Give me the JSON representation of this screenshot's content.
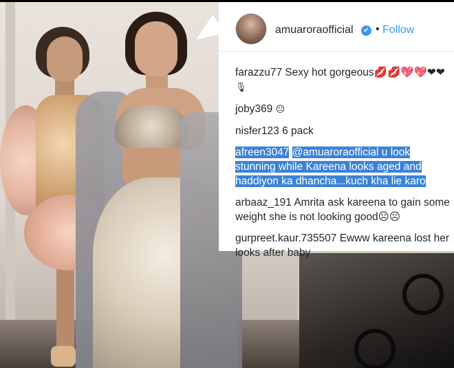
{
  "post": {
    "username": "amuaroraofficial",
    "verified_mark": "✔",
    "separator": "•",
    "follow_label": "Follow"
  },
  "comments": [
    {
      "user": "farazzu77",
      "text": "Sexy hot gorgeous💋💋💖💖❤❤",
      "extra": "🎙"
    },
    {
      "user": "joby369",
      "text": "😐"
    },
    {
      "user": "nisfer123",
      "text": "6 pack"
    },
    {
      "user": "afreen3047",
      "text": "@amuaroraofficial u look stunning while Kareena looks aged and haddiyon ka dhancha...kuch kha lie karo",
      "highlighted": true
    },
    {
      "user": "arbaaz_191",
      "text": "Amrita ask kareena to gain some weight she is not looking good☹☹"
    },
    {
      "user": "gurpreet.kaur.735507",
      "text": "Ewww kareena lost her looks after baby"
    }
  ],
  "colors": {
    "link_blue": "#3897f0",
    "selection_blue": "#3b82d8",
    "text": "#262626"
  },
  "icons": [
    "verified-badge-icon",
    "avatar"
  ]
}
